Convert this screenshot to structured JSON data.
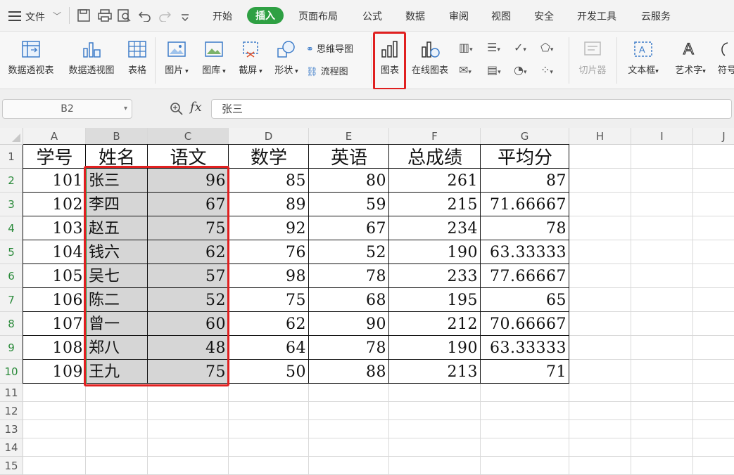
{
  "topbar": {
    "menu_icon": "hamburger-icon",
    "file_label": "文件",
    "quick_icons": [
      "save-icon",
      "print-icon",
      "print-preview-icon",
      "undo-icon",
      "redo-icon",
      "customize-icon"
    ],
    "tabs": [
      {
        "label": "开始",
        "active": false
      },
      {
        "label": "插入",
        "active": true
      },
      {
        "label": "页面布局",
        "active": false
      },
      {
        "label": "公式",
        "active": false
      },
      {
        "label": "数据",
        "active": false
      },
      {
        "label": "审阅",
        "active": false
      },
      {
        "label": "视图",
        "active": false
      },
      {
        "label": "安全",
        "active": false
      },
      {
        "label": "开发工具",
        "active": false
      },
      {
        "label": "云服务",
        "active": false
      }
    ],
    "active_color": "#2ea043"
  },
  "ribbon": {
    "pivot_table": "数据透视表",
    "pivot_chart": "数据透视图",
    "table": "表格",
    "picture": "图片",
    "gallery": "图库",
    "screenshot": "截屏",
    "shape": "形状",
    "mindmap": "思维导图",
    "flowchart": "流程图",
    "chart": "图表",
    "online_chart": "在线图表",
    "slicer": "切片器",
    "textbox": "文本框",
    "wordart": "艺术字",
    "symbol": "符号",
    "highlight_color": "#e02020"
  },
  "formula_bar": {
    "cell_ref": "B2",
    "fx_label": "fx",
    "content": "张三"
  },
  "sheet": {
    "columns": [
      "A",
      "B",
      "C",
      "D",
      "E",
      "F",
      "G",
      "H",
      "I",
      "J"
    ],
    "rows": [
      "1",
      "2",
      "3",
      "4",
      "5",
      "6",
      "7",
      "8",
      "9",
      "10",
      "11",
      "12",
      "13",
      "14",
      "15"
    ],
    "header": [
      "学号",
      "姓名",
      "语文",
      "数学",
      "英语",
      "总成绩",
      "平均分"
    ],
    "data": [
      [
        "101",
        "张三",
        "96",
        "85",
        "80",
        "261",
        "87"
      ],
      [
        "102",
        "李四",
        "67",
        "89",
        "59",
        "215",
        "71.66667"
      ],
      [
        "103",
        "赵五",
        "75",
        "92",
        "67",
        "234",
        "78"
      ],
      [
        "104",
        "钱六",
        "62",
        "76",
        "52",
        "190",
        "63.33333"
      ],
      [
        "105",
        "吴七",
        "57",
        "98",
        "78",
        "233",
        "77.66667"
      ],
      [
        "106",
        "陈二",
        "52",
        "75",
        "68",
        "195",
        "65"
      ],
      [
        "107",
        "曾一",
        "60",
        "62",
        "90",
        "212",
        "70.66667"
      ],
      [
        "108",
        "郑八",
        "48",
        "64",
        "78",
        "190",
        "63.33333"
      ],
      [
        "109",
        "王九",
        "75",
        "50",
        "88",
        "213",
        "71"
      ]
    ],
    "selection": "B2:C10"
  }
}
